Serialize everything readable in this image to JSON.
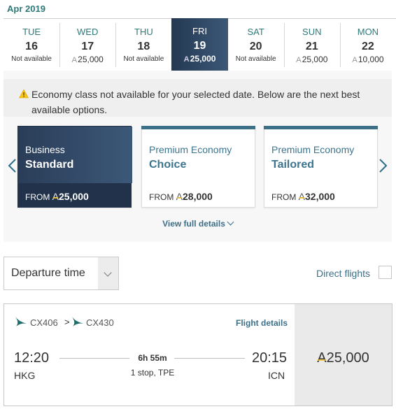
{
  "month_label": "Apr 2019",
  "dates": [
    {
      "dow": "TUE",
      "day": "16",
      "status": "Not available",
      "price": null,
      "selected": false
    },
    {
      "dow": "WED",
      "day": "17",
      "status": null,
      "price": "25,000",
      "selected": false
    },
    {
      "dow": "THU",
      "day": "18",
      "status": "Not available",
      "price": null,
      "selected": false
    },
    {
      "dow": "FRI",
      "day": "19",
      "status": null,
      "price": "25,000",
      "selected": true
    },
    {
      "dow": "SAT",
      "day": "20",
      "status": "Not available",
      "price": null,
      "selected": false
    },
    {
      "dow": "SUN",
      "day": "21",
      "status": null,
      "price": "25,000",
      "selected": false
    },
    {
      "dow": "MON",
      "day": "22",
      "status": null,
      "price": "10,000",
      "selected": false
    }
  ],
  "miles_symbol": "A",
  "alert": {
    "icon": "warning-icon",
    "text": "Economy class not available for your selected date. Below are the next best available options."
  },
  "fare_cards": [
    {
      "cabin": "Business",
      "tier": "Standard",
      "from_label": "FROM",
      "price": "25,000",
      "selected": true
    },
    {
      "cabin": "Premium Economy",
      "tier": "Choice",
      "from_label": "FROM",
      "price": "28,000",
      "selected": false
    },
    {
      "cabin": "Premium Economy",
      "tier": "Tailored",
      "from_label": "FROM",
      "price": "32,000",
      "selected": false
    }
  ],
  "view_full_details": "View full details",
  "sort": {
    "selected": "Departure time"
  },
  "direct_flights": {
    "label": "Direct flights",
    "checked": false
  },
  "flight": {
    "segments": [
      "CX406",
      "CX430"
    ],
    "separator": ">",
    "details_link": "Flight details",
    "departure_time": "12:20",
    "departure_airport": "HKG",
    "arrival_time": "20:15",
    "arrival_airport": "ICN",
    "duration": "6h 55m",
    "stops": "1 stop, TPE",
    "price": "25,000"
  },
  "colors": {
    "accent_teal": "#2c7a78",
    "link_blue": "#3c6f88",
    "selected_navy": "#243952",
    "miles_gold": "#f2c230"
  }
}
